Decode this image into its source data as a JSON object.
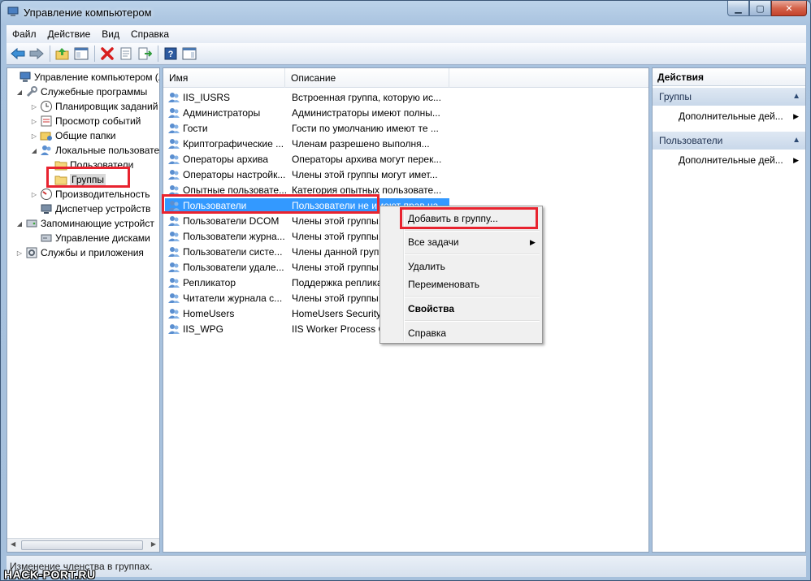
{
  "window": {
    "title": "Управление компьютером"
  },
  "menubar": {
    "items": [
      "Файл",
      "Действие",
      "Вид",
      "Справка"
    ]
  },
  "toolbar": {
    "buttons": [
      "back-icon",
      "forward-icon",
      "up-folder-icon",
      "show-hide-tree-icon",
      "delete-icon",
      "properties-icon",
      "export-list-icon",
      "help-icon",
      "action-pane-icon"
    ]
  },
  "tree": {
    "items": [
      {
        "label": "Управление компьютером (л",
        "icon": "computer-management-icon"
      },
      {
        "label": "Служебные программы",
        "icon": "tools-icon"
      },
      {
        "label": "Планировщик заданий",
        "icon": "clock-icon"
      },
      {
        "label": "Просмотр событий",
        "icon": "event-viewer-icon"
      },
      {
        "label": "Общие папки",
        "icon": "shared-folders-icon"
      },
      {
        "label": "Локальные пользовате",
        "icon": "users-icon"
      },
      {
        "label": "Пользователи",
        "icon": "folder-icon"
      },
      {
        "label": "Группы",
        "icon": "folder-icon"
      },
      {
        "label": "Производительность",
        "icon": "performance-icon"
      },
      {
        "label": "Диспетчер устройств",
        "icon": "device-manager-icon"
      },
      {
        "label": "Запоминающие устройст",
        "icon": "storage-icon"
      },
      {
        "label": "Управление дисками",
        "icon": "disk-icon"
      },
      {
        "label": "Службы и приложения",
        "icon": "services-icon"
      }
    ]
  },
  "list": {
    "columns": [
      "Имя",
      "Описание"
    ],
    "rows": [
      {
        "name": "IIS_IUSRS",
        "desc": "Встроенная группа, которую ис..."
      },
      {
        "name": "Администраторы",
        "desc": "Администраторы имеют полны..."
      },
      {
        "name": "Гости",
        "desc": "Гости по умолчанию имеют те ..."
      },
      {
        "name": "Криптографические ...",
        "desc": "Членам разрешено выполня..."
      },
      {
        "name": "Операторы архива",
        "desc": "Операторы архива могут перек..."
      },
      {
        "name": "Операторы настройк...",
        "desc": "Члены этой группы могут имет..."
      },
      {
        "name": "Опытные пользовате...",
        "desc": "Категория опытных пользовате..."
      },
      {
        "name": "Пользователи",
        "desc": "Пользователи не имеют прав на..."
      },
      {
        "name": "Пользователи DCOM",
        "desc": "Члены этой группы..."
      },
      {
        "name": "Пользователи журна...",
        "desc": "Члены этой группы..."
      },
      {
        "name": "Пользователи систе...",
        "desc": "Члены данной группы..."
      },
      {
        "name": "Пользователи удале...",
        "desc": "Члены этой группы..."
      },
      {
        "name": "Репликатор",
        "desc": "Поддержка репликации..."
      },
      {
        "name": "Читатели журнала с...",
        "desc": "Члены этой группы..."
      },
      {
        "name": "HomeUsers",
        "desc": "HomeUsers Security Group"
      },
      {
        "name": "IIS_WPG",
        "desc": "IIS Worker Process Group"
      }
    ],
    "selected_index": 7
  },
  "actions": {
    "title": "Действия",
    "sections": [
      {
        "title": "Группы",
        "item": "Дополнительные дей..."
      },
      {
        "title": "Пользователи",
        "item": "Дополнительные дей..."
      }
    ]
  },
  "context_menu": {
    "items": [
      "Добавить в группу...",
      "Все задачи",
      "Удалить",
      "Переименовать",
      "Свойства",
      "Справка"
    ]
  },
  "status": {
    "text": "Изменение членства в группах."
  },
  "watermark": {
    "text": "HACK-PORT.RU"
  },
  "colors": {
    "selection": "#3399ff",
    "highlight": "#e8232f"
  }
}
